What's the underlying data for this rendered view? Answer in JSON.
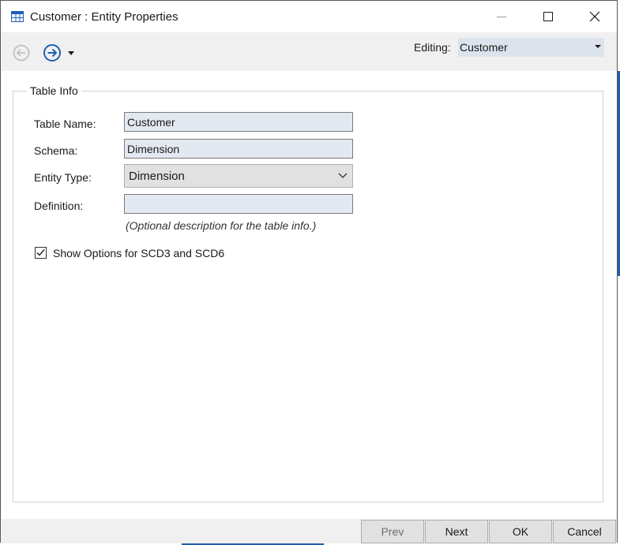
{
  "window": {
    "title": "Customer : Entity Properties"
  },
  "toolbar": {
    "back_icon": "arrow-left-circle-icon",
    "forward_icon": "arrow-right-circle-icon",
    "editing_label": "Editing:",
    "editing_value": "Customer"
  },
  "group": {
    "legend": "Table Info"
  },
  "form": {
    "table_name_label": "Table Name:",
    "table_name_value": "Customer",
    "schema_label": "Schema:",
    "schema_value": "Dimension",
    "entity_type_label": "Entity Type:",
    "entity_type_value": "Dimension",
    "definition_label": "Definition:",
    "definition_value": "",
    "definition_hint": "(Optional description for the table info.)",
    "show_options_label": "Show Options for SCD3 and SCD6",
    "show_options_checked": true
  },
  "footer": {
    "prev_label": "Prev",
    "next_label": "Next",
    "ok_label": "OK",
    "cancel_label": "Cancel"
  },
  "colors": {
    "accent": "#1e5fb4",
    "field_bg": "#e3e9f1",
    "window_bg": "#f0f0f0"
  }
}
